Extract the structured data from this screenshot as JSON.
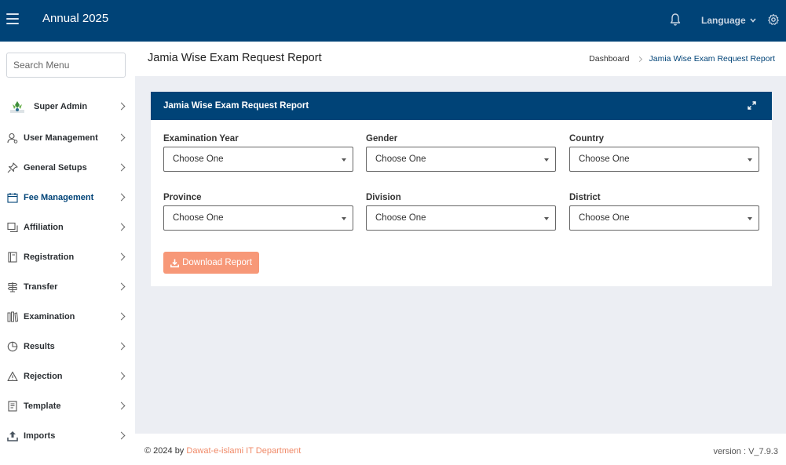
{
  "topbar": {
    "title": "Annual 2025",
    "language_label": "Language"
  },
  "sidebar": {
    "search_placeholder": "Search Menu",
    "items": [
      {
        "label": "Super Admin",
        "icon": "admin-logo-icon"
      },
      {
        "label": "User Management",
        "icon": "user-icon"
      },
      {
        "label": "General Setups",
        "icon": "pin-icon"
      },
      {
        "label": "Fee Management",
        "icon": "calendar-icon",
        "active": true
      },
      {
        "label": "Affiliation",
        "icon": "copy-icon"
      },
      {
        "label": "Registration",
        "icon": "book-icon"
      },
      {
        "label": "Transfer",
        "icon": "signpost-icon"
      },
      {
        "label": "Examination",
        "icon": "books-icon"
      },
      {
        "label": "Results",
        "icon": "pie-chart-icon"
      },
      {
        "label": "Rejection",
        "icon": "warning-icon"
      },
      {
        "label": "Template",
        "icon": "document-icon"
      },
      {
        "label": "Imports",
        "icon": "upload-icon"
      }
    ]
  },
  "header": {
    "title": "Jamia Wise Exam Request Report",
    "breadcrumb_home": "Dashboard",
    "breadcrumb_current": "Jamia Wise Exam Request Report"
  },
  "card": {
    "title": "Jamia Wise Exam Request Report",
    "fields": [
      {
        "label": "Examination Year",
        "value": "Choose One"
      },
      {
        "label": "Gender",
        "value": "Choose One"
      },
      {
        "label": "Country",
        "value": "Choose One"
      },
      {
        "label": "Province",
        "value": "Choose One"
      },
      {
        "label": "Division",
        "value": "Choose One"
      },
      {
        "label": "District",
        "value": "Choose One"
      }
    ],
    "download_label": "Download Report"
  },
  "footer": {
    "copyright_prefix": "© 2024 by",
    "copyright_link": "Dawat-e-islami IT Department",
    "version": "version : V_7.9.3"
  },
  "colors": {
    "primary": "#004377",
    "accent": "#f79878",
    "background": "#eceef3"
  }
}
